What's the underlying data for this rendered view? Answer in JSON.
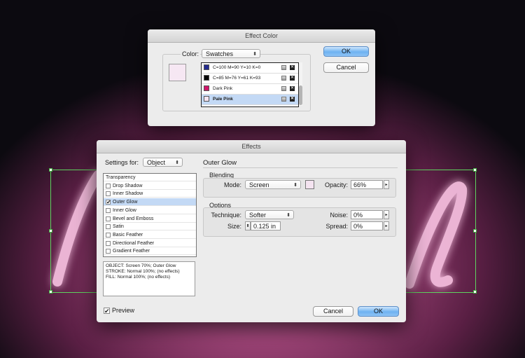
{
  "effect_color_dialog": {
    "title": "Effect Color",
    "color_label": "Color:",
    "color_mode": "Swatches",
    "ok_label": "OK",
    "cancel_label": "Cancel",
    "preview_swatch_color": "#f6e7f3",
    "swatches": [
      {
        "name": "C=100 M=90 Y=10 K=0",
        "color": "#232b8f"
      },
      {
        "name": "C=85 M=76 Y=61 K=93",
        "color": "#050505"
      },
      {
        "name": "Dark Pink",
        "color": "#d0166a"
      },
      {
        "name": "Pale Pink",
        "color": "#f4e3f0"
      }
    ],
    "selected_swatch": "Pale Pink"
  },
  "effects_dialog": {
    "title": "Effects",
    "settings_for_label": "Settings for:",
    "settings_for_value": "Object",
    "effects_list": [
      {
        "label": "Transparency",
        "has_checkbox": false,
        "checked": false
      },
      {
        "label": "Drop Shadow",
        "has_checkbox": true,
        "checked": false
      },
      {
        "label": "Inner Shadow",
        "has_checkbox": true,
        "checked": false
      },
      {
        "label": "Outer Glow",
        "has_checkbox": true,
        "checked": true
      },
      {
        "label": "Inner Glow",
        "has_checkbox": true,
        "checked": false
      },
      {
        "label": "Bevel and Emboss",
        "has_checkbox": true,
        "checked": false
      },
      {
        "label": "Satin",
        "has_checkbox": true,
        "checked": false
      },
      {
        "label": "Basic Feather",
        "has_checkbox": true,
        "checked": false
      },
      {
        "label": "Directional Feather",
        "has_checkbox": true,
        "checked": false
      },
      {
        "label": "Gradient Feather",
        "has_checkbox": true,
        "checked": false
      }
    ],
    "selected_effect": "Outer Glow",
    "summary_lines": [
      "OBJECT: Screen 70%; Outer Glow",
      "STROKE: Normal 100%; (no effects)",
      "FILL: Normal 100%; (no effects)"
    ],
    "section_title": "Outer Glow",
    "blending": {
      "title": "Blending",
      "mode_label": "Mode:",
      "mode_value": "Screen",
      "glow_color": "#f4e3f0",
      "opacity_label": "Opacity:",
      "opacity_value": "66%"
    },
    "options": {
      "title": "Options",
      "technique_label": "Technique:",
      "technique_value": "Softer",
      "size_label": "Size:",
      "size_value": "0.125 in",
      "noise_label": "Noise:",
      "noise_value": "0%",
      "spread_label": "Spread:",
      "spread_value": "0%"
    },
    "preview_label": "Preview",
    "preview_checked": true,
    "cancel_label": "Cancel",
    "ok_label": "OK"
  },
  "icons": {
    "checkbox_check": "✔",
    "dropdown_arrow": "⬍",
    "slider_arrow": "▸",
    "stepper": "⬍",
    "delete_swatch": "✕"
  }
}
